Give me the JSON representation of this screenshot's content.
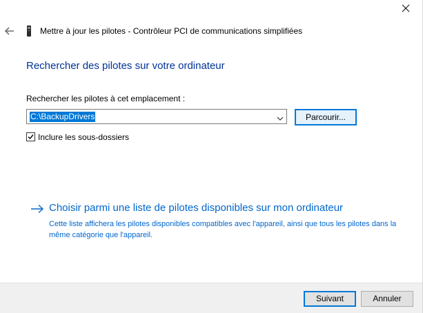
{
  "window": {
    "title": "Mettre à jour les pilotes - Contrôleur PCI de communications simplifiées",
    "close_icon": "close-icon",
    "back_icon": "back-arrow-icon",
    "device_icon": "device-icon"
  },
  "main": {
    "heading": "Rechercher des pilotes sur votre ordinateur",
    "location_label": "Rechercher les pilotes à cet emplacement :",
    "path_value": "C:\\BackupDrivers",
    "browse_label": "Parcourir...",
    "include_subfolders_label": "Inclure les sous-dossiers",
    "include_subfolders_checked": true,
    "pick_list_title": "Choisir parmi une liste de pilotes disponibles sur mon ordinateur",
    "pick_list_description": "Cette liste affichera les pilotes disponibles compatibles avec l'appareil, ainsi que tous les pilotes dans la même catégorie que l'appareil."
  },
  "footer": {
    "next_label": "Suivant",
    "cancel_label": "Annuler"
  },
  "colors": {
    "heading": "#003399",
    "link": "#0066cc",
    "selection": "#0078d7",
    "footer_bg": "#f0f0f0"
  }
}
